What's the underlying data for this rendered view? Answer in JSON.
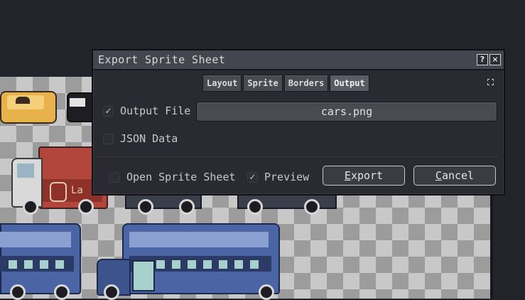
{
  "dialog": {
    "title": "Export Sprite Sheet",
    "help_button": "?",
    "close_button": "×"
  },
  "tabs": [
    {
      "label": "Layout",
      "active": false
    },
    {
      "label": "Sprite",
      "active": false
    },
    {
      "label": "Borders",
      "active": false
    },
    {
      "label": "Output",
      "active": true
    }
  ],
  "output_file": {
    "checked": true,
    "label": "Output File",
    "value": "cars.png"
  },
  "json_data": {
    "checked": false,
    "label": "JSON Data"
  },
  "open_sprite_sheet": {
    "checked": false,
    "label": "Open Sprite Sheet"
  },
  "preview": {
    "checked": true,
    "label": "Preview"
  },
  "buttons": {
    "export_mnemonic": "E",
    "export_rest": "xport",
    "cancel_mnemonic": "C",
    "cancel_rest": "ancel"
  },
  "canvas": {
    "sprite_sign": "La"
  },
  "icons": {
    "check": "✓"
  },
  "colors": {
    "dialog_bg": "#2a2a32",
    "titlebar_bg": "#45454f",
    "tab_bg": "#4a4a53",
    "field_bg": "#4a4a53",
    "button_border": "#c9c9c9",
    "text": "#c8c8c8"
  }
}
